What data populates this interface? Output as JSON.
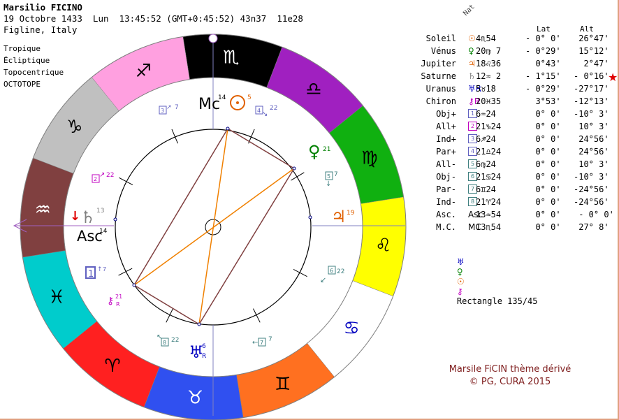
{
  "header": {
    "name": "Marsilio FICINO",
    "datetime": "19 Octobre 1433  Lun  13:45:52 (GMT+0:45:52) 43n37  11e28",
    "place": "Figline, Italy"
  },
  "options": [
    "Tropique",
    "Écliptique",
    "Topocentrique",
    "OCTOTOPE"
  ],
  "table": {
    "nat_label": "Nat",
    "col_lat": "Lat",
    "col_alt": "Alt",
    "rows": [
      {
        "name": "Soleil",
        "glyph": "☉",
        "color": "#e06000",
        "pos": "4♏54",
        "lat": "- 0° 0'",
        "alt": " 26°47'"
      },
      {
        "name": "Vénus",
        "glyph": "♀",
        "color": "#008000",
        "pos": "20♍ 7",
        "lat": "- 0°29'",
        "alt": " 15°12'"
      },
      {
        "name": "Jupiter",
        "glyph": "♃",
        "color": "#e06000",
        "pos": "18♌36",
        "lat": "  0°43'",
        "alt": "  2°47'"
      },
      {
        "name": "Saturne",
        "glyph": "♄",
        "color": "#808080",
        "pos": "12♒ 2",
        "lat": "- 1°15'",
        "alt": "- 0°16'"
      },
      {
        "name": "Uranus",
        "glyph": "♅R",
        "color": "#0000c0",
        "pos": "5♉18",
        "lat": "- 0°29'",
        "alt": "-27°17'"
      },
      {
        "name": "Chiron",
        "glyph": "⚷R",
        "color": "#c000c0",
        "pos": "20♓35",
        "lat": "  3°53'",
        "alt": "-12°13'"
      },
      {
        "name": "Obj+",
        "glyph": "1",
        "color": "#6060c0",
        "pos": "6♒24",
        "lat": "  0° 0'",
        "alt": "-10° 3'"
      },
      {
        "name": "All+",
        "glyph": "2",
        "color": "#c000c0",
        "pos": "21♑24",
        "lat": "  0° 0'",
        "alt": " 10° 3'"
      },
      {
        "name": "Ind+",
        "glyph": "3",
        "color": "#6060c0",
        "pos": "6♐24",
        "lat": "  0° 0'",
        "alt": " 24°56'"
      },
      {
        "name": "Par+",
        "glyph": "4",
        "color": "#6060c0",
        "pos": "21♎24",
        "lat": "  0° 0'",
        "alt": " 24°56'"
      },
      {
        "name": "All-",
        "glyph": "5",
        "color": "#408080",
        "pos": "6♍24",
        "lat": "  0° 0'",
        "alt": " 10° 3'"
      },
      {
        "name": "Obj-",
        "glyph": "6",
        "color": "#408080",
        "pos": "21♋24",
        "lat": "  0° 0'",
        "alt": "-10° 3'"
      },
      {
        "name": "Par-",
        "glyph": "7",
        "color": "#408080",
        "pos": "6♊24",
        "lat": "  0° 0'",
        "alt": "-24°56'"
      },
      {
        "name": "Ind-",
        "glyph": "8",
        "color": "#408080",
        "pos": "21♈24",
        "lat": "  0° 0'",
        "alt": "-24°56'"
      },
      {
        "name": "Asc.",
        "glyph": "Asc",
        "color": "#000000",
        "pos": "13♒54",
        "lat": "  0° 0'",
        "alt": " - 0° 0'"
      },
      {
        "name": "M.C.",
        "glyph": "MC",
        "color": "#000000",
        "pos": "13♏54",
        "lat": "  0° 0'",
        "alt": " 27° 8'"
      }
    ]
  },
  "rectangle": {
    "glyphs": [
      "♅",
      "♀",
      "☉",
      "⚷"
    ],
    "glyph_colors": [
      "#0000c0",
      "#008000",
      "#e06000",
      "#c000c0"
    ],
    "label": "Rectangle 135/45"
  },
  "credit": [
    "Marsile FiCIN thème dérivé",
    "© PG, CURA 2015"
  ],
  "star": "★",
  "wheel": {
    "signs": [
      {
        "glyph": "♏",
        "color": "#000000",
        "text": "#ffffff"
      },
      {
        "glyph": "♎",
        "color": "#a020c0",
        "text": "#000000"
      },
      {
        "glyph": "♍",
        "color": "#10b010",
        "text": "#000000"
      },
      {
        "glyph": "♌",
        "color": "#ffff00",
        "text": "#000000"
      },
      {
        "glyph": "♋",
        "color": "#ffffff",
        "text": "#0000c0"
      },
      {
        "glyph": "♊",
        "color": "#ff7020",
        "text": "#000000"
      },
      {
        "glyph": "♉",
        "color": "#3050f0",
        "text": "#ffffff"
      },
      {
        "glyph": "♈",
        "color": "#ff2020",
        "text": "#000000"
      },
      {
        "glyph": "♓",
        "color": "#00cccc",
        "text": "#000000"
      },
      {
        "glyph": "♒",
        "color": "#804040",
        "text": "#ffffff"
      },
      {
        "glyph": "♑",
        "color": "#c0c0c0",
        "text": "#000000"
      },
      {
        "glyph": "♐",
        "color": "#ffa0e0",
        "text": "#000000"
      }
    ],
    "labels": {
      "mc": "Mc",
      "mc_deg": "14",
      "sun_deg": "5",
      "venus_deg": "21",
      "jupiter_deg": "19",
      "saturn_deg": "13",
      "asc": "Asc",
      "asc_deg": "14",
      "uranus_deg": "6",
      "uranus_r": "R",
      "chiron_deg": "21",
      "chiron_r": "R",
      "h1": "1",
      "h1_deg": "7",
      "h2": "2",
      "h2_deg": "22",
      "h3": "3",
      "h3_deg": "7",
      "h4": "4",
      "h4_deg": "22",
      "h5": "5",
      "h5_deg": "7",
      "h6": "6",
      "h6_deg": "22",
      "h7": "7",
      "h7_deg": "7",
      "h8": "8",
      "h8_deg": "22"
    }
  }
}
